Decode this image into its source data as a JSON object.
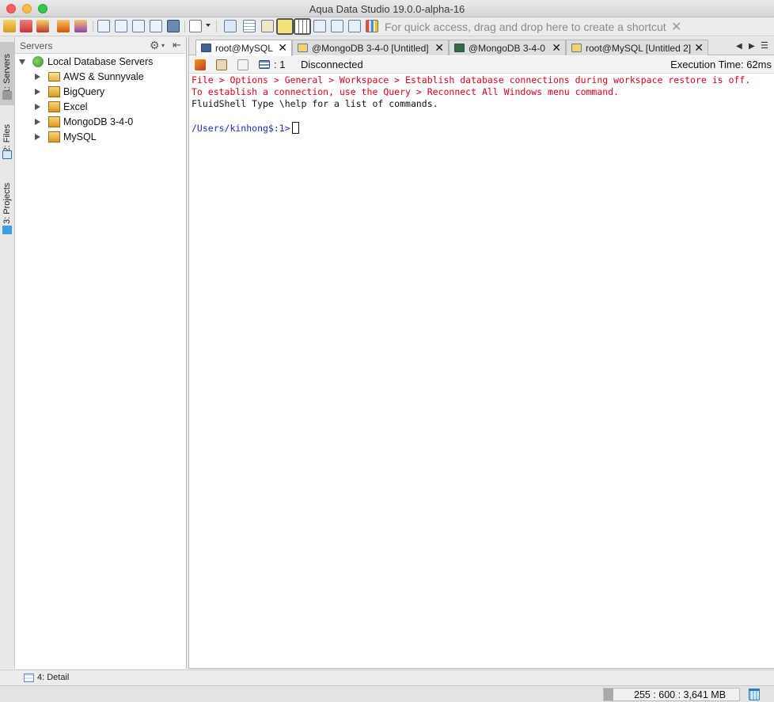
{
  "window": {
    "title": "Aqua Data Studio 19.0.0-alpha-16"
  },
  "toolbar": {
    "shortcut_hint": "For quick access, drag and drop here to create a shortcut",
    "shortcut_close": "✕"
  },
  "side_tabs": {
    "servers": "1: Servers",
    "files": "2: Files",
    "projects": "3: Projects"
  },
  "servers_panel": {
    "title": "Servers",
    "gear": "⚙",
    "caret": "▾",
    "pin": "⇤",
    "root": "Local Database Servers",
    "items": [
      {
        "label": "AWS & Sunnyvale",
        "icon": "folder-icon"
      },
      {
        "label": "BigQuery",
        "icon": "server-icon"
      },
      {
        "label": "Excel",
        "icon": "server-icon"
      },
      {
        "label": "MongoDB 3-4-0",
        "icon": "server-icon"
      },
      {
        "label": "MySQL",
        "icon": "server-icon"
      }
    ]
  },
  "editor": {
    "tabs": [
      {
        "label": "root@MySQL",
        "icon": "shell-icon",
        "close": "✕"
      },
      {
        "label": "@MongoDB 3-4-0 [Untitled]",
        "icon": "query-icon",
        "close": "✕"
      },
      {
        "label": "@MongoDB 3-4-0",
        "icon": "shell-icon",
        "close": "✕"
      },
      {
        "label": "root@MySQL [Untitled 2]",
        "icon": "query-icon",
        "close": "✕"
      }
    ],
    "nav": {
      "prev": "◀",
      "next": "▶",
      "menu": "☰"
    },
    "shell": {
      "count": ": 1",
      "status": "Disconnected",
      "execution_time": "Execution Time: 62ms"
    },
    "console": {
      "error_line1": "File > Options > General > Workspace > Establish database connections during workspace restore is off.",
      "error_line2": "To establish a connection, use the Query > Reconnect All Windows menu command.",
      "info_line": "FluidShell Type \\help for a list of commands.",
      "prompt": "/Users/kinhong$:1>"
    }
  },
  "bottom": {
    "detail_label": "4: Detail"
  },
  "status": {
    "memory": "255 : 600 : 3,641 MB",
    "memory_fraction": 0.07
  },
  "colors": {
    "error": "#e0001b",
    "prompt": "#1f2ac8"
  }
}
